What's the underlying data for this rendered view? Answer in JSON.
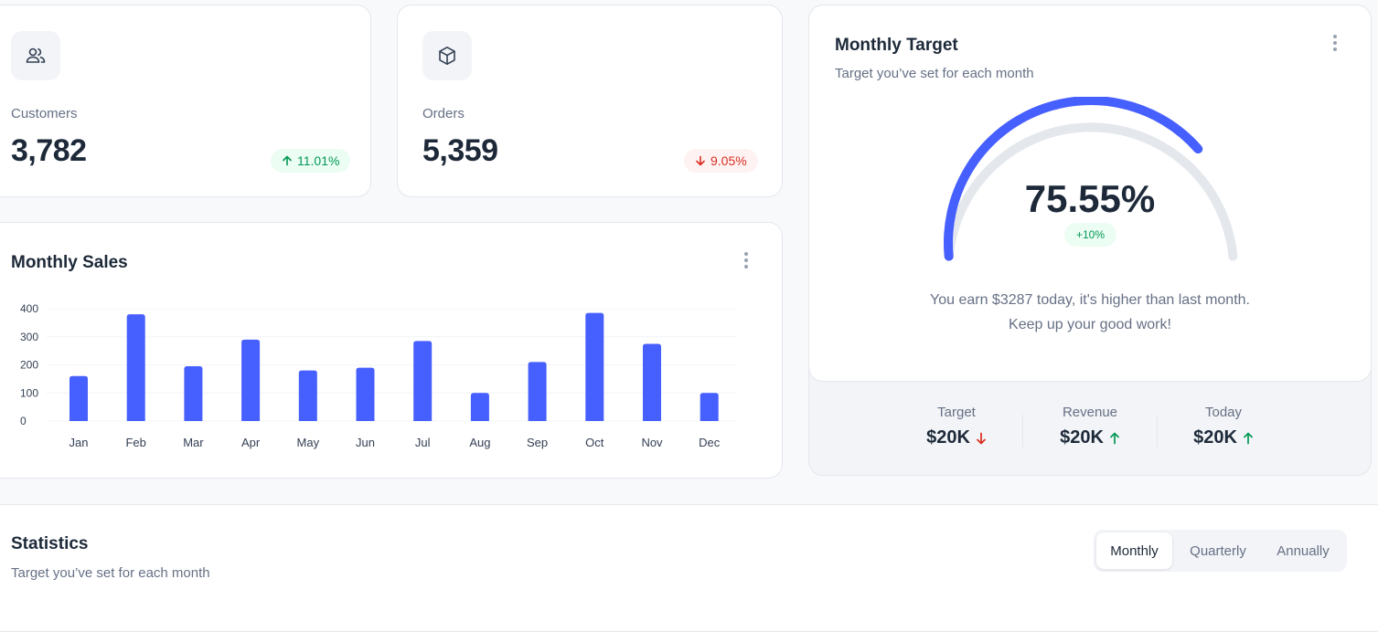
{
  "colors": {
    "accent": "#465fff",
    "success": "#039855",
    "danger": "#d92d20",
    "muted": "#667085",
    "text": "#1d2939",
    "track": "#e4e7ec"
  },
  "metrics": {
    "customers": {
      "icon": "users-icon",
      "label": "Customers",
      "value": "3,782",
      "change": "11.01%",
      "direction": "up"
    },
    "orders": {
      "icon": "box-icon",
      "label": "Orders",
      "value": "5,359",
      "change": "9.05%",
      "direction": "down"
    }
  },
  "monthly_sales": {
    "title": "Monthly Sales",
    "menu_icon": "more-vertical-icon"
  },
  "monthly_target": {
    "title": "Monthly Target",
    "subtitle": "Target you’ve set for each month",
    "menu_icon": "more-vertical-icon",
    "progress": 0.7555,
    "value_text": "75.55%",
    "badge": "+10%",
    "message_line1": "You earn $3287 today, it's higher than last month.",
    "message_line2": "Keep up your good work!",
    "stats": [
      {
        "label": "Target",
        "value": "$20K",
        "direction": "down"
      },
      {
        "label": "Revenue",
        "value": "$20K",
        "direction": "up"
      },
      {
        "label": "Today",
        "value": "$20K",
        "direction": "up"
      }
    ]
  },
  "statistics": {
    "title": "Statistics",
    "subtitle": "Target you’ve set for each month",
    "tabs": [
      "Monthly",
      "Quarterly",
      "Annually"
    ],
    "active_tab": "Monthly"
  },
  "chart_data": {
    "type": "bar",
    "title": "",
    "xlabel": "",
    "ylabel": "",
    "categories": [
      "Jan",
      "Feb",
      "Mar",
      "Apr",
      "May",
      "Jun",
      "Jul",
      "Aug",
      "Sep",
      "Oct",
      "Nov",
      "Dec"
    ],
    "values": [
      160,
      380,
      195,
      290,
      180,
      190,
      285,
      100,
      210,
      385,
      275,
      100
    ],
    "ylim": [
      0,
      400
    ],
    "yticks": [
      0,
      100,
      200,
      300,
      400
    ],
    "grid": true,
    "legend": "none",
    "bar_color": "#465fff"
  }
}
